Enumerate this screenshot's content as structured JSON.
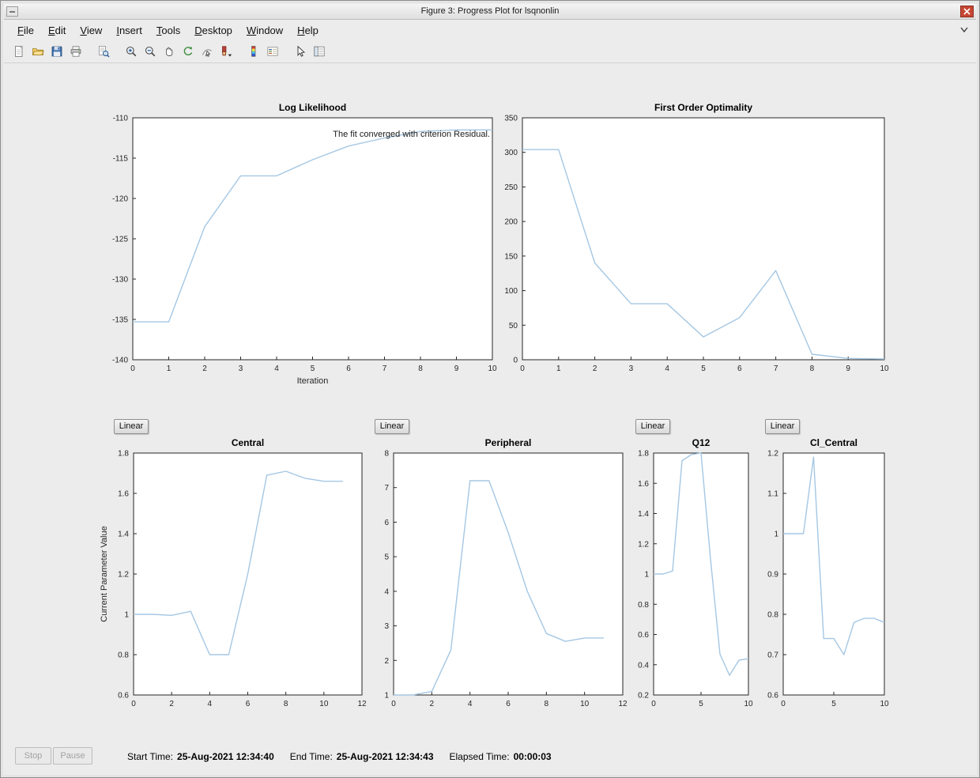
{
  "window": {
    "title": "Figure 3: Progress Plot for lsqnonlin"
  },
  "menu": {
    "items": [
      {
        "label": "File"
      },
      {
        "label": "Edit"
      },
      {
        "label": "View"
      },
      {
        "label": "Insert"
      },
      {
        "label": "Tools"
      },
      {
        "label": "Desktop"
      },
      {
        "label": "Window"
      },
      {
        "label": "Help"
      }
    ]
  },
  "toolbar": {
    "groups": [
      [
        "new-figure-icon",
        "open-file-icon",
        "save-figure-icon",
        "print-figure-icon"
      ],
      [
        "print-preview-icon"
      ],
      [
        "zoom-in-icon",
        "zoom-out-icon",
        "pan-icon",
        "rotate-3d-icon",
        "data-cursor-icon",
        "brush-icon"
      ],
      [
        "insert-colorbar-icon",
        "insert-legend-icon"
      ],
      [
        "edit-plot-icon",
        "plot-browser-icon"
      ]
    ]
  },
  "scale_buttons": {
    "label": "Linear"
  },
  "status": {
    "stop_label": "Stop",
    "pause_label": "Pause",
    "start_time_label": "Start Time:",
    "start_time": "25-Aug-2021 12:34:40",
    "end_time_label": "End Time:",
    "end_time": "25-Aug-2021 12:34:43",
    "elapsed_label": "Elapsed Time:",
    "elapsed": "00:00:03"
  },
  "chart_data": [
    {
      "id": "log-likelihood",
      "type": "line",
      "title": "Log Likelihood",
      "xlabel": "Iteration",
      "ylabel": "",
      "xlim": [
        0,
        10
      ],
      "ylim": [
        -140,
        -110
      ],
      "xticks": [
        0,
        1,
        2,
        3,
        4,
        5,
        6,
        7,
        8,
        9,
        10
      ],
      "yticks": [
        -140,
        -135,
        -130,
        -125,
        -120,
        -115,
        -110
      ],
      "x": [
        0,
        1,
        2,
        3,
        4,
        5,
        6,
        7,
        8,
        9,
        10
      ],
      "y": [
        -135.3,
        -135.3,
        -123.5,
        -117.2,
        -117.2,
        -115.2,
        -113.5,
        -112.5,
        -111.7,
        -111.5,
        -111.5
      ],
      "line_color": "#a5c7e3",
      "annotation": "The fit converged with criterion Residual."
    },
    {
      "id": "first-order-optimality",
      "type": "line",
      "title": "First Order Optimality",
      "xlabel": "",
      "ylabel": "",
      "xlim": [
        0,
        10
      ],
      "ylim": [
        0,
        350
      ],
      "xticks": [
        0,
        1,
        2,
        3,
        4,
        5,
        6,
        7,
        8,
        9,
        10
      ],
      "yticks": [
        0,
        50,
        100,
        150,
        200,
        250,
        300,
        350
      ],
      "x": [
        0,
        1,
        2,
        3,
        4,
        5,
        6,
        7,
        8,
        9,
        10
      ],
      "y": [
        304,
        304,
        140,
        81,
        81,
        33,
        61,
        129,
        8,
        2,
        1
      ],
      "line_color": "#a5c7e3"
    },
    {
      "id": "central",
      "type": "line",
      "title": "Central",
      "xlabel": "",
      "ylabel": "Current Parameter Value",
      "xlim": [
        0,
        12
      ],
      "ylim": [
        0.6,
        1.8
      ],
      "xticks": [
        0,
        2,
        4,
        6,
        8,
        10,
        12
      ],
      "yticks": [
        0.6,
        0.8,
        1,
        1.2,
        1.4,
        1.6,
        1.8
      ],
      "x": [
        0,
        1,
        2,
        3,
        4,
        5,
        6,
        7,
        8,
        9,
        10,
        11
      ],
      "y": [
        1.0,
        1.0,
        0.995,
        1.015,
        0.8,
        0.8,
        1.2,
        1.69,
        1.71,
        1.675,
        1.66,
        1.66
      ],
      "line_color": "#a5c7e3"
    },
    {
      "id": "peripheral",
      "type": "line",
      "title": "Peripheral",
      "xlabel": "",
      "ylabel": "",
      "xlim": [
        0,
        12
      ],
      "ylim": [
        1,
        8
      ],
      "xticks": [
        0,
        2,
        4,
        6,
        8,
        10,
        12
      ],
      "yticks": [
        1,
        2,
        3,
        4,
        5,
        6,
        7,
        8
      ],
      "x": [
        0,
        1,
        2,
        3,
        4,
        5,
        6,
        7,
        8,
        9,
        10,
        11
      ],
      "y": [
        1.0,
        1.0,
        1.1,
        2.3,
        7.2,
        7.2,
        5.7,
        4.0,
        2.78,
        2.55,
        2.65,
        2.65
      ],
      "line_color": "#a5c7e3"
    },
    {
      "id": "q12",
      "type": "line",
      "title": "Q12",
      "xlabel": "",
      "ylabel": "",
      "xlim": [
        0,
        10
      ],
      "ylim": [
        0.2,
        1.8
      ],
      "xticks": [
        0,
        5,
        10
      ],
      "yticks": [
        0.2,
        0.4,
        0.6,
        0.8,
        1,
        1.2,
        1.4,
        1.6,
        1.8
      ],
      "x": [
        0,
        1,
        2,
        3,
        4,
        5,
        6,
        7,
        8,
        9,
        10
      ],
      "y": [
        1.0,
        1.0,
        1.02,
        1.75,
        1.79,
        1.8,
        1.1,
        0.47,
        0.33,
        0.43,
        0.44
      ],
      "line_color": "#a5c7e3"
    },
    {
      "id": "cl-central",
      "type": "line",
      "title": "Cl_Central",
      "xlabel": "",
      "ylabel": "",
      "xlim": [
        0,
        10
      ],
      "ylim": [
        0.6,
        1.2
      ],
      "xticks": [
        0,
        5,
        10
      ],
      "yticks": [
        0.6,
        0.7,
        0.8,
        0.9,
        1,
        1.1,
        1.2
      ],
      "x": [
        0,
        1,
        2,
        3,
        4,
        5,
        6,
        7,
        8,
        9,
        10
      ],
      "y": [
        1.0,
        1.0,
        1.0,
        1.19,
        0.74,
        0.74,
        0.7,
        0.78,
        0.79,
        0.79,
        0.78
      ],
      "line_color": "#a5c7e3"
    }
  ]
}
